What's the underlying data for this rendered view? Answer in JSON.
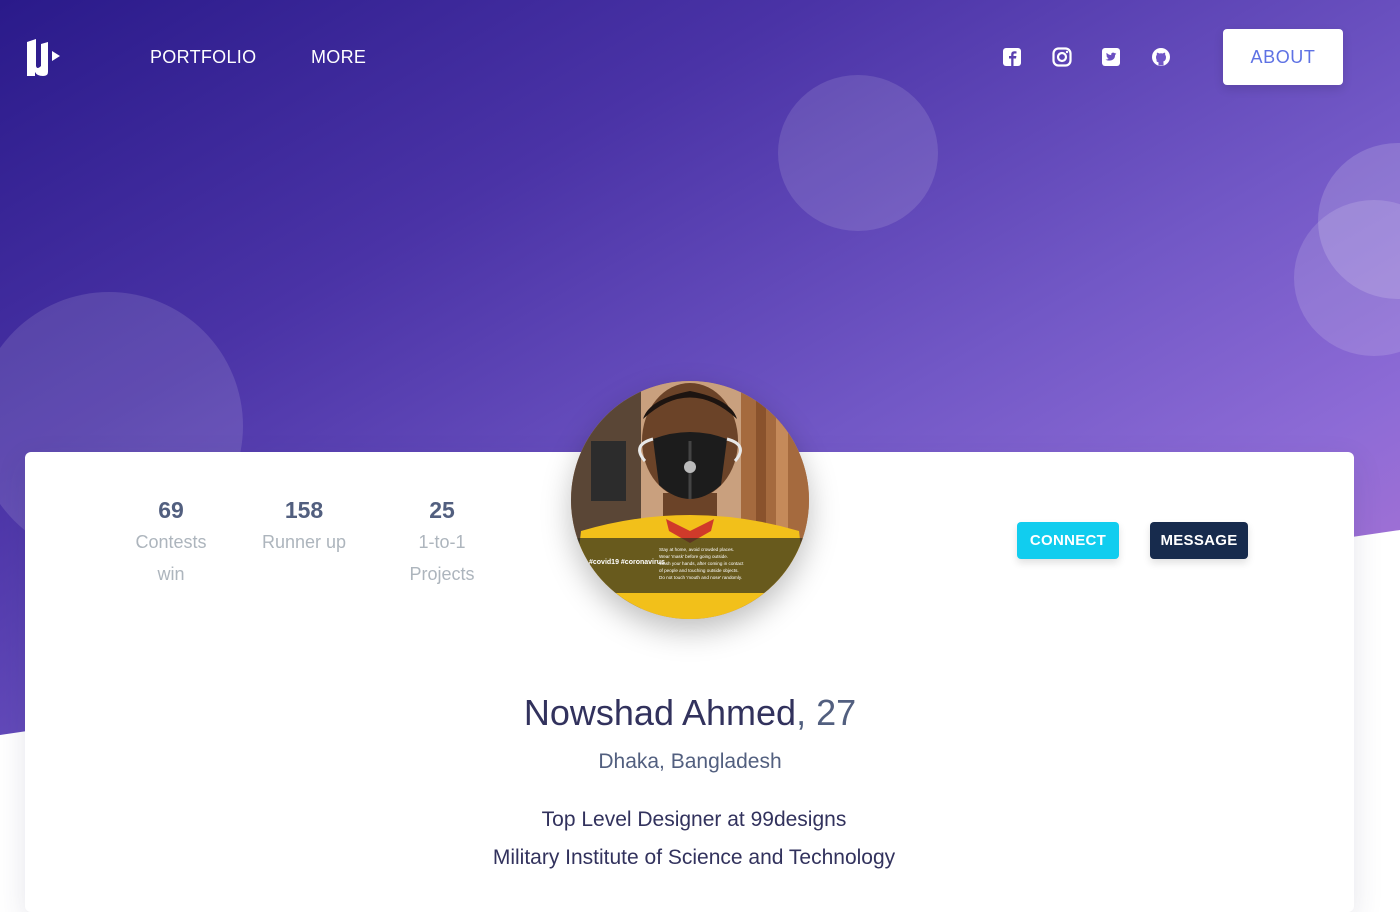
{
  "nav": {
    "links": [
      "PORTFOLIO",
      "MORE"
    ],
    "about_label": "ABOUT",
    "social_icons": [
      "facebook-icon",
      "instagram-icon",
      "twitter-icon",
      "github-icon"
    ]
  },
  "profile": {
    "stats": [
      {
        "value": "69",
        "label": "Contests win"
      },
      {
        "value": "158",
        "label": "Runner up"
      },
      {
        "value": "25",
        "label": "1-to-1 Projects"
      }
    ],
    "connect_label": "CONNECT",
    "message_label": "MESSAGE",
    "name": "Nowshad Ahmed",
    "age": ", 27",
    "location": "Dhaka, Bangladesh",
    "job": "Top Level Designer at 99designs",
    "school": "Military Institute of Science and Technology",
    "photo_caption": "#covid19 #coronavirus",
    "photo_tips": [
      "Stay at home, avoid crowded places.",
      "Wear 'mask' before going outside.",
      "Wash your hands, after coming in contact",
      "of people and touching outside objects.",
      "Do not touch 'mouth and nose' randomly."
    ]
  },
  "colors": {
    "accent": "#5e72e4",
    "connect": "#11cdef",
    "message": "#172b4d",
    "gradient_start": "#2a1a8a",
    "gradient_end": "#c47ad2"
  }
}
